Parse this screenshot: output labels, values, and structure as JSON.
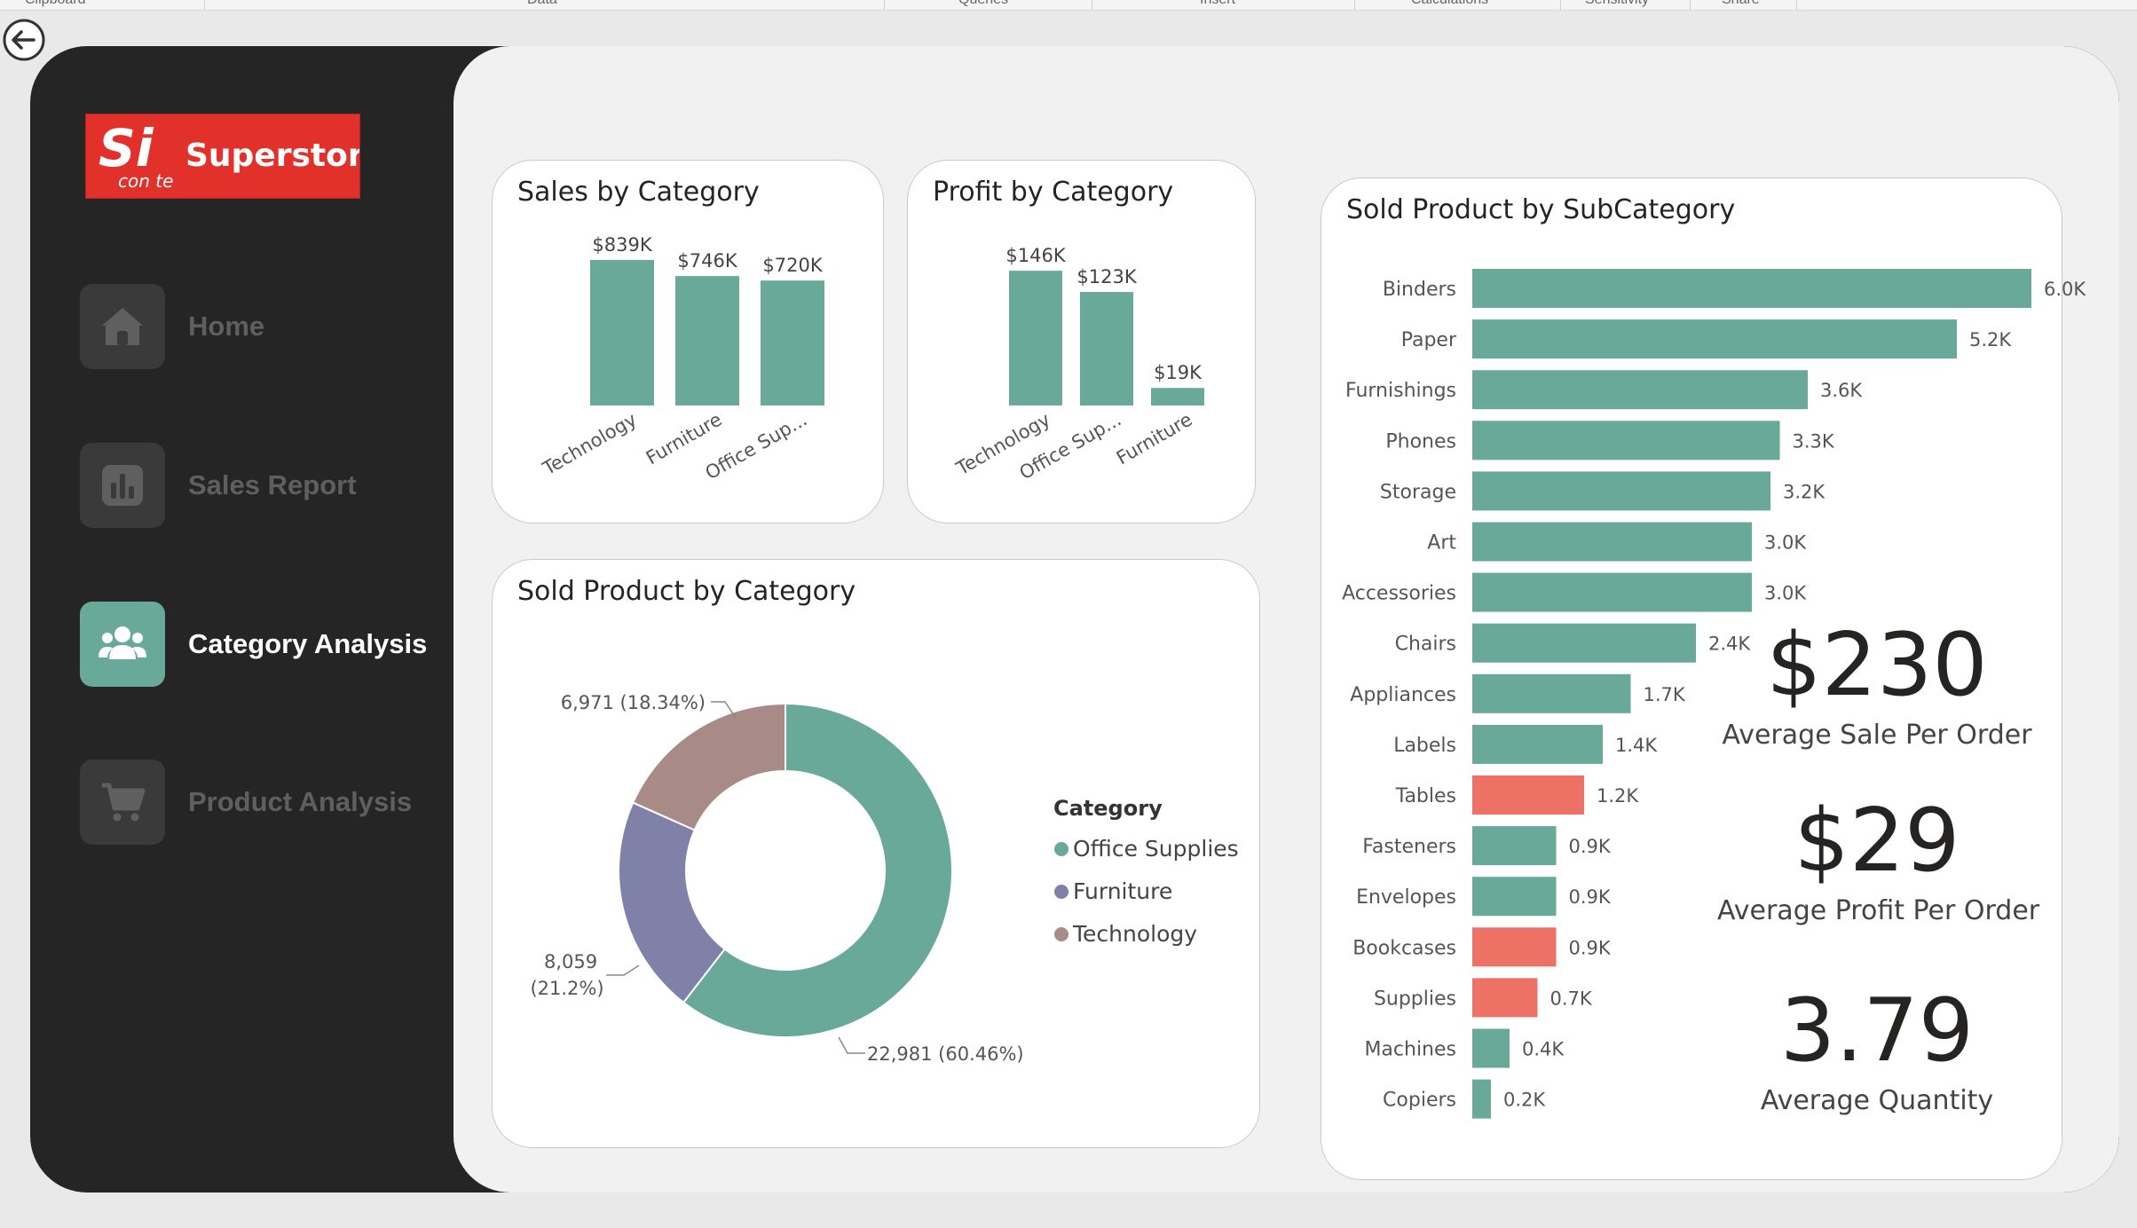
{
  "ribbon": {
    "groups": [
      "Clipboard",
      "Data",
      "Queries",
      "Insert",
      "Calculations",
      "Sensitivity",
      "Share"
    ]
  },
  "back_icon": "back-arrow-icon",
  "logo": {
    "brand_mark": "Si",
    "tagline": "con te",
    "brand_name": "Superstore",
    "color": "#e2302a"
  },
  "nav": {
    "items": [
      {
        "label": "Home",
        "icon": "home-icon",
        "active": false
      },
      {
        "label": "Sales Report",
        "icon": "bar-chart-icon",
        "active": false
      },
      {
        "label": "Category Analysis",
        "icon": "users-icon",
        "active": true
      },
      {
        "label": "Product Analysis",
        "icon": "cart-icon",
        "active": false
      }
    ],
    "active_color": "#68a99a"
  },
  "colors": {
    "teal": "#68a99a",
    "purple": "#8081a8",
    "mauve": "#a88b86",
    "salmon": "#ee7166"
  },
  "sales_by_category": {
    "title": "Sales by Category",
    "chart_data": {
      "type": "bar",
      "categories": [
        "Technology",
        "Furniture",
        "Office Sup..."
      ],
      "values": [
        839,
        746,
        720
      ],
      "labels": [
        "$839K",
        "$746K",
        "$720K"
      ],
      "unit": "K$",
      "ylim": [
        0,
        900
      ]
    }
  },
  "profit_by_category": {
    "title": "Profit by Category",
    "chart_data": {
      "type": "bar",
      "categories": [
        "Technology",
        "Office Sup...",
        "Furniture"
      ],
      "values": [
        146,
        123,
        19
      ],
      "labels": [
        "$146K",
        "$123K",
        "$19K"
      ],
      "unit": "K$",
      "ylim": [
        0,
        150
      ]
    }
  },
  "sold_by_category": {
    "title": "Sold Product by Category",
    "chart_data": {
      "type": "pie",
      "donut": true,
      "legend_title": "Category",
      "legend_position": "right",
      "slices": [
        {
          "name": "Office Supplies",
          "value": 22981,
          "percent": 60.46,
          "label": "22,981 (60.46%)",
          "color": "#68a99a"
        },
        {
          "name": "Furniture",
          "value": 8059,
          "percent": 21.2,
          "label_line1": "8,059",
          "label_line2": "(21.2%)",
          "color": "#8081a8"
        },
        {
          "name": "Technology",
          "value": 6971,
          "percent": 18.34,
          "label": "6,971 (18.34%)",
          "color": "#a88b86"
        }
      ]
    }
  },
  "sold_by_subcategory": {
    "title": "Sold Product by SubCategory",
    "chart_data": {
      "type": "bar",
      "orientation": "horizontal",
      "categories": [
        "Binders",
        "Paper",
        "Furnishings",
        "Phones",
        "Storage",
        "Art",
        "Accessories",
        "Chairs",
        "Appliances",
        "Labels",
        "Tables",
        "Fasteners",
        "Envelopes",
        "Bookcases",
        "Supplies",
        "Machines",
        "Copiers"
      ],
      "values": [
        6.0,
        5.2,
        3.6,
        3.3,
        3.2,
        3.0,
        3.0,
        2.4,
        1.7,
        1.4,
        1.2,
        0.9,
        0.9,
        0.9,
        0.7,
        0.4,
        0.2
      ],
      "labels": [
        "6.0K",
        "5.2K",
        "3.6K",
        "3.3K",
        "3.2K",
        "3.0K",
        "3.0K",
        "2.4K",
        "1.7K",
        "1.4K",
        "1.2K",
        "0.9K",
        "0.9K",
        "0.9K",
        "0.7K",
        "0.4K",
        "0.2K"
      ],
      "highlighted": [
        false,
        false,
        false,
        false,
        false,
        false,
        false,
        false,
        false,
        false,
        true,
        false,
        false,
        true,
        true,
        false,
        false
      ],
      "unit": "K",
      "xlim": [
        0,
        6.0
      ]
    }
  },
  "kpis": [
    {
      "value": "$230",
      "label": "Average Sale Per Order"
    },
    {
      "value": "$29",
      "label": "Average Profit Per Order"
    },
    {
      "value": "3.79",
      "label": "Average Quantity"
    }
  ]
}
